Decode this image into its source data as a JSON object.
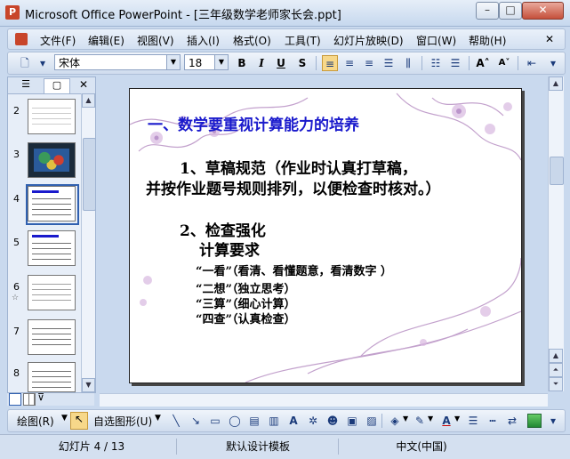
{
  "window": {
    "app_icon": "P",
    "title": "Microsoft Office PowerPoint - [三年级数学老师家长会.ppt]",
    "minimize": "–",
    "maximize": "□",
    "close": "✕"
  },
  "menu": {
    "items": [
      "文件(F)",
      "编辑(E)",
      "视图(V)",
      "插入(I)",
      "格式(O)",
      "工具(T)",
      "幻灯片放映(D)",
      "窗口(W)",
      "帮助(H)"
    ]
  },
  "toolbar": {
    "font_name": "宋体",
    "font_size": "18",
    "bold": "B",
    "italic": "I",
    "underline": "U",
    "shadow": "S"
  },
  "thumbnails": {
    "numbers": [
      "2",
      "3",
      "4",
      "5",
      "6",
      "7",
      "8"
    ],
    "selected": "4"
  },
  "slide": {
    "heading": "一、数学要重视计算能力的培养",
    "point1_line1": "1、草稿规范（作业时认真打草稿，",
    "point1_line2": "并按作业题号规则排列，以便检查时核对。）",
    "point2": "2、检查强化",
    "point2_sub": "计算要求",
    "items": [
      "“一看”（看清、看懂题意，看清数字 ）",
      "“二想”（独立思考）",
      "“三算”（细心计算）",
      "“四查”（认真检查）"
    ]
  },
  "drawing_toolbar": {
    "draw_label": "绘图(R)",
    "autoshape_label": "自选图形(U)"
  },
  "status": {
    "slide_info": "幻灯片 4 / 13",
    "design": "默认设计模板",
    "language": "中文(中国)"
  },
  "colors": {
    "heading": "#1a1acc",
    "accent": "#3060b0"
  }
}
